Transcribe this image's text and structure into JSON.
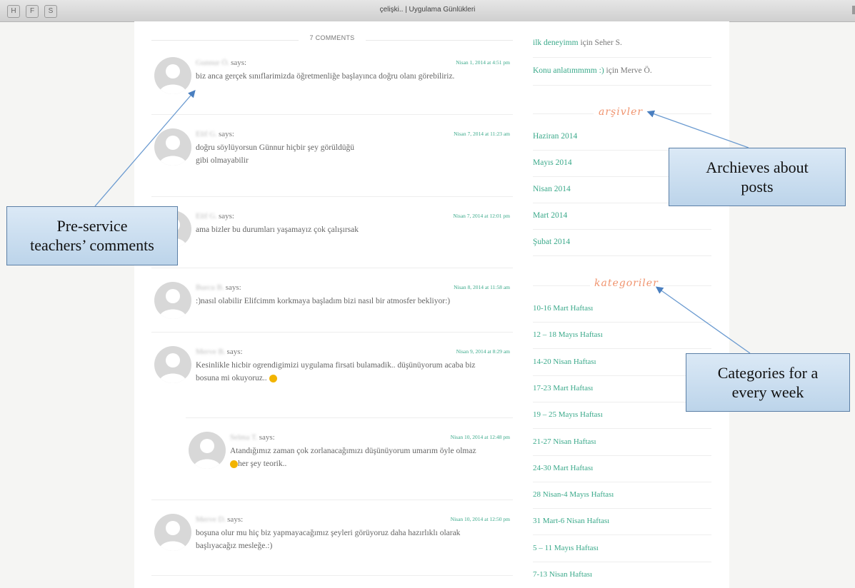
{
  "window": {
    "title": "çelişki.. | Uygulama Günlükleri",
    "buttons": [
      {
        "icon": "close-icon",
        "glyph": "H"
      },
      {
        "icon": "minimize-icon",
        "glyph": "F"
      },
      {
        "icon": "maximize-icon",
        "glyph": "S"
      }
    ]
  },
  "comments_count_label": "7 COMMENTS",
  "comments": [
    {
      "author": "Gunnur Ö.",
      "says": "says:",
      "date": "Nisan 1, 2014 at 4:51 pm",
      "lines": [
        "biz anca gerçek sınıflarimizda öğretmenliğe başlayınca doğru olanı görebiliriz."
      ]
    },
    {
      "author": "Elif G.",
      "says": "says:",
      "date": "Nisan 7, 2014 at 11:23 am",
      "lines": [
        "doğru söylüyorsun Günnur hiçbir şey görüldüğü",
        "gibi olmayabilir"
      ]
    },
    {
      "author": "Elif G.",
      "says": "says:",
      "date": "Nisan 7, 2014 at 12:01 pm",
      "lines": [
        "ama bizler bu durumları yaşamayız çok çalışırsak"
      ]
    },
    {
      "author": "Burcu B.",
      "says": "says:",
      "date": "Nisan 8, 2014 at 11:58 am",
      "lines": [
        ":)nasıl olabilir Elifcimm korkmaya başladım bizi nasıl bir atmosfer bekliyor:)"
      ]
    },
    {
      "author": "Merve B.",
      "says": "says:",
      "date": "Nisan 9, 2014 at 8:29 am",
      "lines": [
        "Kesinlikle hicbir ogrendigimizi uygulama firsati bulamadik.. düşünüyorum acaba biz",
        "bosuna mi okuyoruz.."
      ],
      "emoji_end": true
    },
    {
      "author": "Selma T.",
      "says": "says:",
      "date": "Nisan 10, 2014 at 12:48 pm",
      "lines": [
        "Atandığımız zaman çok zorlanacağımızı düşünüyorum umarım öyle olmaz",
        "her şey teorik.."
      ],
      "emoji_start_line2": true
    },
    {
      "author": "Merve D.",
      "says": "says:",
      "date": "Nisan 10, 2014 at 12:50 pm",
      "lines": [
        "boşuna olur mu hiç biz yapmayacağımız şeyleri görüyoruz daha hazırlıklı olarak",
        "başlıyacağız mesleğe.:)"
      ]
    }
  ],
  "recent_comments": [
    {
      "link": "ilk deneyimm",
      "rest": " için Seher S."
    },
    {
      "link": "Konu anlatımmmm :)",
      "rest": " için Merve Ö."
    }
  ],
  "archives": {
    "title": "arşivler",
    "items": [
      "Haziran 2014",
      "Mayıs 2014",
      "Nisan 2014",
      "Mart 2014",
      "Şubat 2014"
    ]
  },
  "categories": {
    "title": "kategoriler",
    "items": [
      "10-16 Mart Haftası",
      "12 – 18 Mayıs Haftası",
      "14-20 Nisan Haftası",
      "17-23 Mart Haftası",
      "19 – 25 Mayıs Haftası",
      "21-27 Nisan Haftası",
      "24-30 Mart Haftası",
      "28 Nisan-4 Mayıs Haftası",
      "31 Mart-6 Nisan Haftası",
      "5 – 11 Mayıs Haftası",
      "7-13 Nisan Haftası"
    ]
  },
  "annotations": {
    "comments": [
      "Pre-service",
      "teachers’ comments"
    ],
    "archives": [
      "Archieves about",
      "posts"
    ],
    "categories": [
      "Categories for a",
      "every week"
    ]
  },
  "colors": {
    "link": "#3aa98a",
    "widget_title": "#f0946f",
    "annotation_fill": "#c9ddef",
    "annotation_border": "#5b7fa6"
  }
}
